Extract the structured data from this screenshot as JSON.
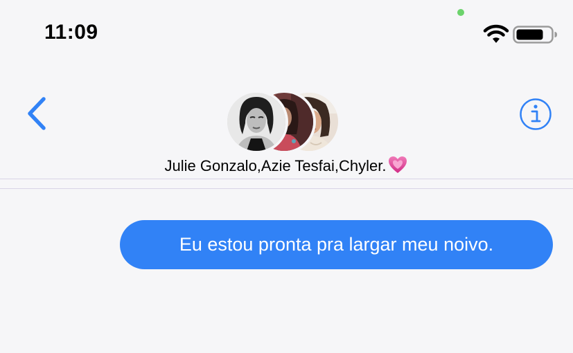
{
  "status_bar": {
    "time": "11:09",
    "wifi_icon": "wifi-icon",
    "battery_icon": "battery-icon",
    "battery_level": 0.75
  },
  "header": {
    "back_icon": "chevron-left-icon",
    "info_icon": "info-icon",
    "group_name": "Julie Gonzalo,Azie Tesfai,Chyler.",
    "group_emoji_icon": "pink-heart-icon"
  },
  "conversation": {
    "messages": [
      {
        "sender": "me",
        "text": "Eu estou pronta pra largar meu noivo."
      }
    ]
  },
  "colors": {
    "accent": "#3182f6",
    "background": "#f6f6f8",
    "camera_indicator": "#6cd36c"
  }
}
